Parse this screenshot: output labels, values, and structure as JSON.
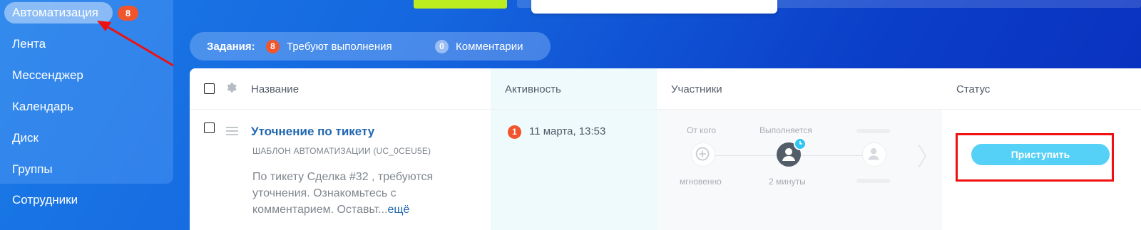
{
  "sidebar": {
    "items": [
      {
        "label": "Автоматизация",
        "badge": "8",
        "active": true
      },
      {
        "label": "Лента"
      },
      {
        "label": "Мессенджер"
      },
      {
        "label": "Календарь"
      },
      {
        "label": "Диск"
      },
      {
        "label": "Группы"
      },
      {
        "label": "Сотрудники"
      }
    ]
  },
  "tasks_bar": {
    "title": "Задания:",
    "pending_count": "8",
    "pending_label": "Требуют выполнения",
    "comments_count": "0",
    "comments_label": "Комментарии"
  },
  "table": {
    "headers": {
      "name": "Название",
      "activity": "Активность",
      "participants": "Участники",
      "status": "Статус"
    },
    "row": {
      "title": "Уточнение по тикету",
      "template": "ШАБЛОН АВТОМАТИЗАЦИИ (UC_0CEU5E)",
      "description": "По тикету Сделка #32 , требуются уточнения. Ознакомьтесь с комментарием. Оставьт...",
      "more": "ещё",
      "activity_count": "1",
      "activity_date": "11 марта, 13:53",
      "participants": {
        "from_label": "От кого",
        "from_time": "мгновенно",
        "executing_label": "Выполняется",
        "executing_time": "2 минуты"
      },
      "status_button": "Приступить"
    }
  },
  "colors": {
    "accent_red": "#f2552c",
    "link_blue": "#2067b0",
    "button_cyan": "#55d0f6",
    "highlight_frame": "#f01010",
    "top_green": "#bbed21"
  }
}
